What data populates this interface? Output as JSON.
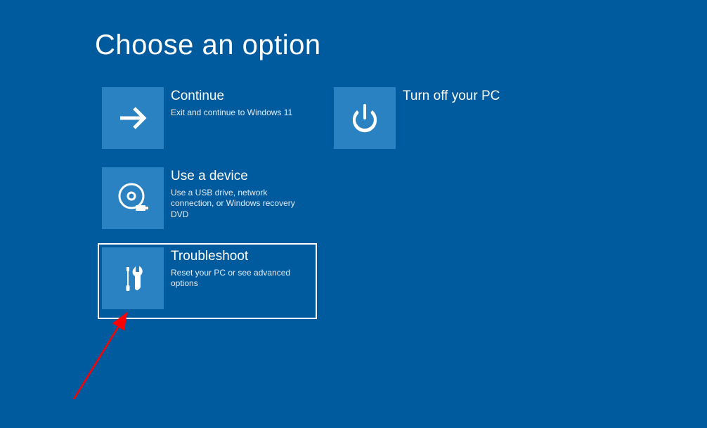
{
  "page_title": "Choose an option",
  "tiles": {
    "continue": {
      "title": "Continue",
      "subtitle": "Exit and continue to Windows 11"
    },
    "turn_off": {
      "title": "Turn off your PC"
    },
    "use_device": {
      "title": "Use a device",
      "subtitle": "Use a USB drive, network connection, or Windows recovery DVD"
    },
    "troubleshoot": {
      "title": "Troubleshoot",
      "subtitle": "Reset your PC or see advanced options"
    }
  }
}
